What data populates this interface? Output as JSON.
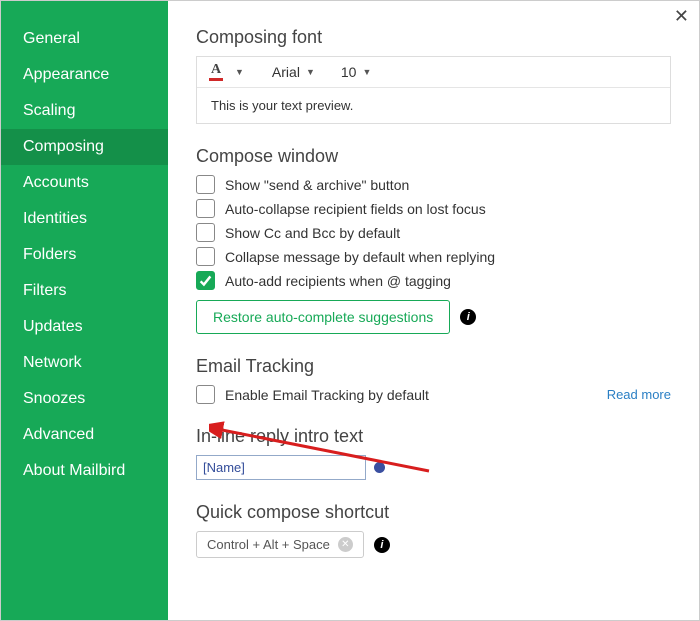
{
  "sidebar": {
    "items": [
      {
        "label": "General"
      },
      {
        "label": "Appearance"
      },
      {
        "label": "Scaling"
      },
      {
        "label": "Composing",
        "active": true
      },
      {
        "label": "Accounts"
      },
      {
        "label": "Identities"
      },
      {
        "label": "Folders"
      },
      {
        "label": "Filters"
      },
      {
        "label": "Updates"
      },
      {
        "label": "Network"
      },
      {
        "label": "Snoozes"
      },
      {
        "label": "Advanced"
      },
      {
        "label": "About Mailbird"
      }
    ]
  },
  "font_section": {
    "title": "Composing font",
    "font_name": "Arial",
    "font_size": "10",
    "preview": "This is your text preview."
  },
  "compose_window": {
    "title": "Compose window",
    "options": [
      {
        "label": "Show \"send & archive\" button",
        "checked": false
      },
      {
        "label": "Auto-collapse recipient fields on lost focus",
        "checked": false
      },
      {
        "label": "Show Cc and Bcc by default",
        "checked": false
      },
      {
        "label": "Collapse message by default when replying",
        "checked": false
      },
      {
        "label": "Auto-add recipients when @ tagging",
        "checked": true
      }
    ],
    "restore_label": "Restore auto-complete suggestions"
  },
  "email_tracking": {
    "title": "Email Tracking",
    "option_label": "Enable Email Tracking by default",
    "read_more": "Read more"
  },
  "inline_reply": {
    "title": "In-line reply intro text",
    "value": "[Name]"
  },
  "quick_compose": {
    "title": "Quick compose shortcut",
    "value": "Control + Alt + Space"
  },
  "info_glyph": "i"
}
